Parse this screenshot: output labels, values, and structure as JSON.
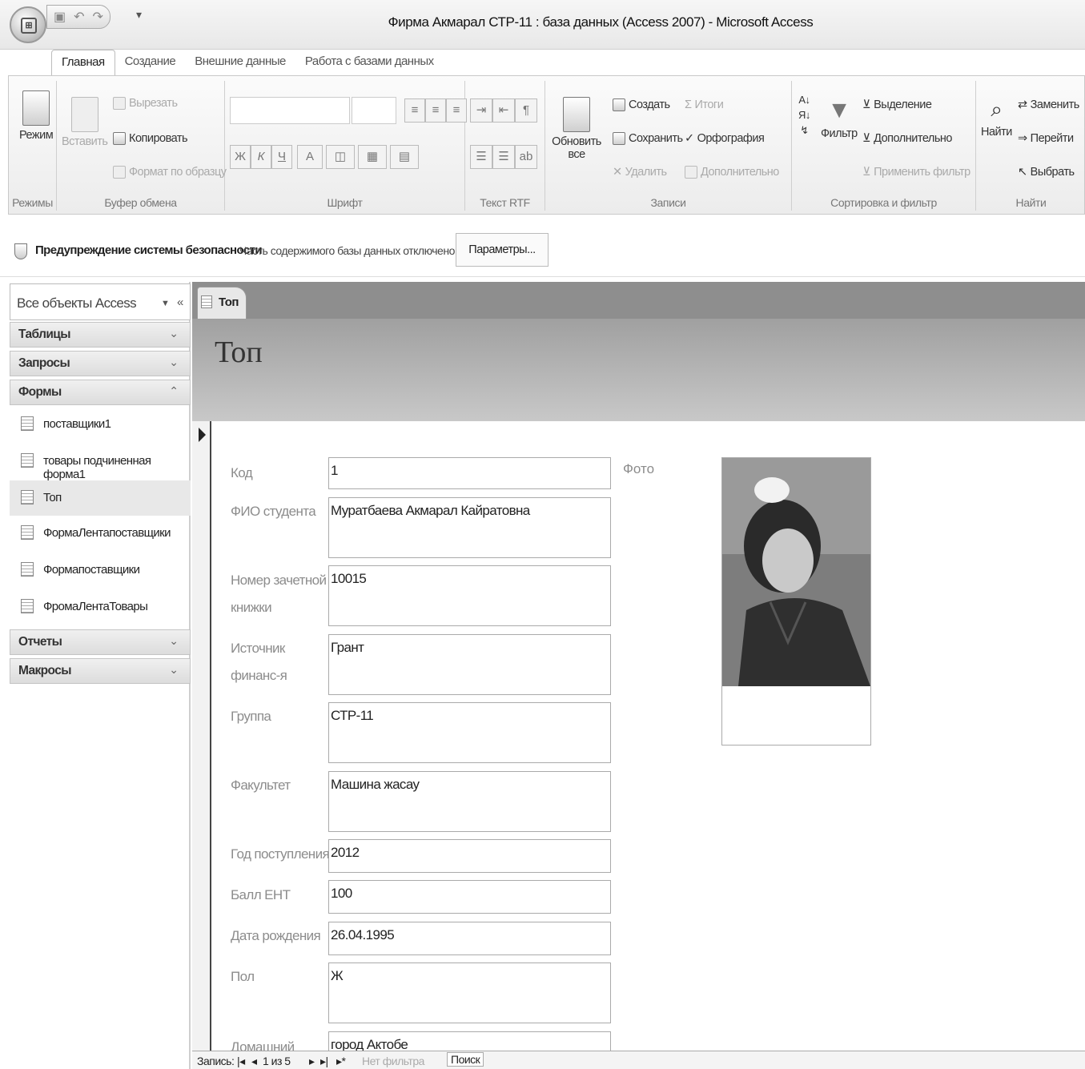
{
  "window": {
    "title": "Фирма Акмарал СТР-11 : база данных (Access 2007) - Microsoft Access"
  },
  "tabs": [
    "Главная",
    "Создание",
    "Внешние данные",
    "Работа с базами данных"
  ],
  "ribbon": {
    "modes": {
      "button": "Режим",
      "label": "Режимы"
    },
    "clipboard": {
      "paste": "Вставить",
      "cut": "Вырезать",
      "copy": "Копировать",
      "format_painter": "Формат по образцу",
      "label": "Буфер обмена"
    },
    "font": {
      "bold": "Ж",
      "italic": "К",
      "underline": "Ч",
      "label": "Шрифт"
    },
    "rtf": {
      "label": "Текст RTF"
    },
    "records": {
      "refresh": "Обновить все",
      "create": "Создать",
      "save": "Сохранить",
      "delete": "Удалить",
      "totals": "Итоги",
      "spelling": "Орфография",
      "more": "Дополнительно",
      "label": "Записи"
    },
    "sort_filter": {
      "filter": "Фильтр",
      "selection": "Выделение",
      "advanced": "Дополнительно",
      "apply": "Применить фильтр",
      "label": "Сортировка и фильтр"
    },
    "find": {
      "find": "Найти",
      "replace": "Заменить",
      "goto": "Перейти",
      "select": "Выбрать",
      "label": "Найти"
    }
  },
  "security": {
    "title": "Предупреждение системы безопасности",
    "message": "Часть содержимого базы данных отключено",
    "button": "Параметры..."
  },
  "nav": {
    "title": "Все объекты Access",
    "groups": {
      "tables": "Таблицы",
      "queries": "Запросы",
      "forms": "Формы",
      "reports": "Отчеты",
      "macros": "Макросы"
    },
    "forms": [
      "поставщики1",
      "товары подчиненная форма1",
      "Топ",
      "ФормаЛентапоставщики",
      "Формапоставщики",
      "ФромаЛентаТовары"
    ]
  },
  "doc": {
    "tab": "Топ",
    "form_title": "Топ",
    "fields": [
      {
        "label": "Код",
        "value": "1"
      },
      {
        "label": "ФИО студента",
        "value": "Муратбаева Акмарал Кайратовна"
      },
      {
        "label": "Номер зачетной книжки",
        "value": "10015"
      },
      {
        "label": "Источник финанс-я",
        "value": "Грант"
      },
      {
        "label": "Группа",
        "value": "СТР-11"
      },
      {
        "label": "Факультет",
        "value": "Машина жасау"
      },
      {
        "label": "Год поступления",
        "value": "2012"
      },
      {
        "label": "Балл ЕНТ",
        "value": "100"
      },
      {
        "label": "Дата рождения",
        "value": "26.04.1995"
      },
      {
        "label": "Пол",
        "value": "Ж"
      },
      {
        "label": "Домашний",
        "value": "город Актобе"
      }
    ],
    "photo_label": "Фото"
  },
  "recnav": {
    "label": "Запись:",
    "position": "1 из 5",
    "filter": "Нет фильтра",
    "search": "Поиск"
  }
}
